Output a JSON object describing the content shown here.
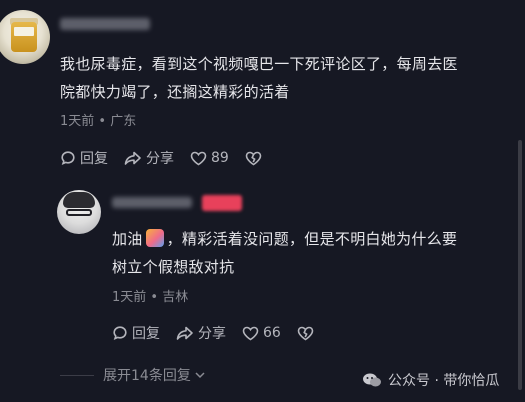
{
  "comment1": {
    "text_line1": "我也尿毒症，看到这个视频嘎巴一下死评论区了，每周去医",
    "text_line2": "院都快力竭了，还搁这精彩的活着",
    "time": "1天前",
    "location": "广东",
    "reply_label": "回复",
    "share_label": "分享",
    "like_count": "89"
  },
  "reply1": {
    "text_pre": "加油",
    "text_post": "，精彩活着没问题，但是不明白她为什么要",
    "text_line2": "树立个假想敌对抗",
    "time": "1天前",
    "location": "吉林",
    "reply_label": "回复",
    "share_label": "分享",
    "like_count": "66"
  },
  "expand_label": "展开14条回复",
  "watermark": "公众号 · 带你恰瓜",
  "separator": "•"
}
